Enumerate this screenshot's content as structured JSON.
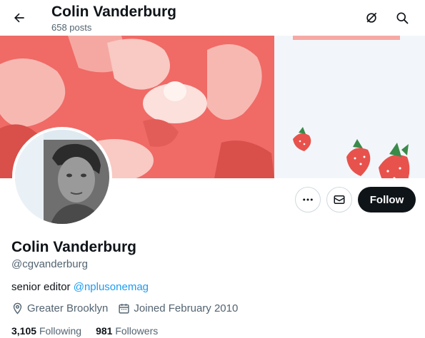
{
  "header": {
    "title": "Colin Vanderburg",
    "post_count": "658 posts",
    "back_icon": "arrow-left-icon",
    "grok_icon": "grok-icon",
    "search_icon": "search-icon"
  },
  "profile": {
    "name": "Colin Vanderburg",
    "handle": "@cgvanderburg",
    "bio_text": "senior editor ",
    "bio_mention": "@nplusonemag",
    "location": "Greater Brooklyn",
    "joined": "Joined February 2010",
    "following_count": "3,105",
    "following_label": "Following",
    "followers_count": "981",
    "followers_label": "Followers"
  },
  "actions": {
    "more_icon": "more-icon",
    "message_icon": "mail-icon",
    "follow_label": "Follow"
  },
  "colors": {
    "accent": "#1d9bf0",
    "follow_bg": "#0f1419",
    "banner_red": "#f06a66",
    "banner_light": "#f2f6fa"
  }
}
